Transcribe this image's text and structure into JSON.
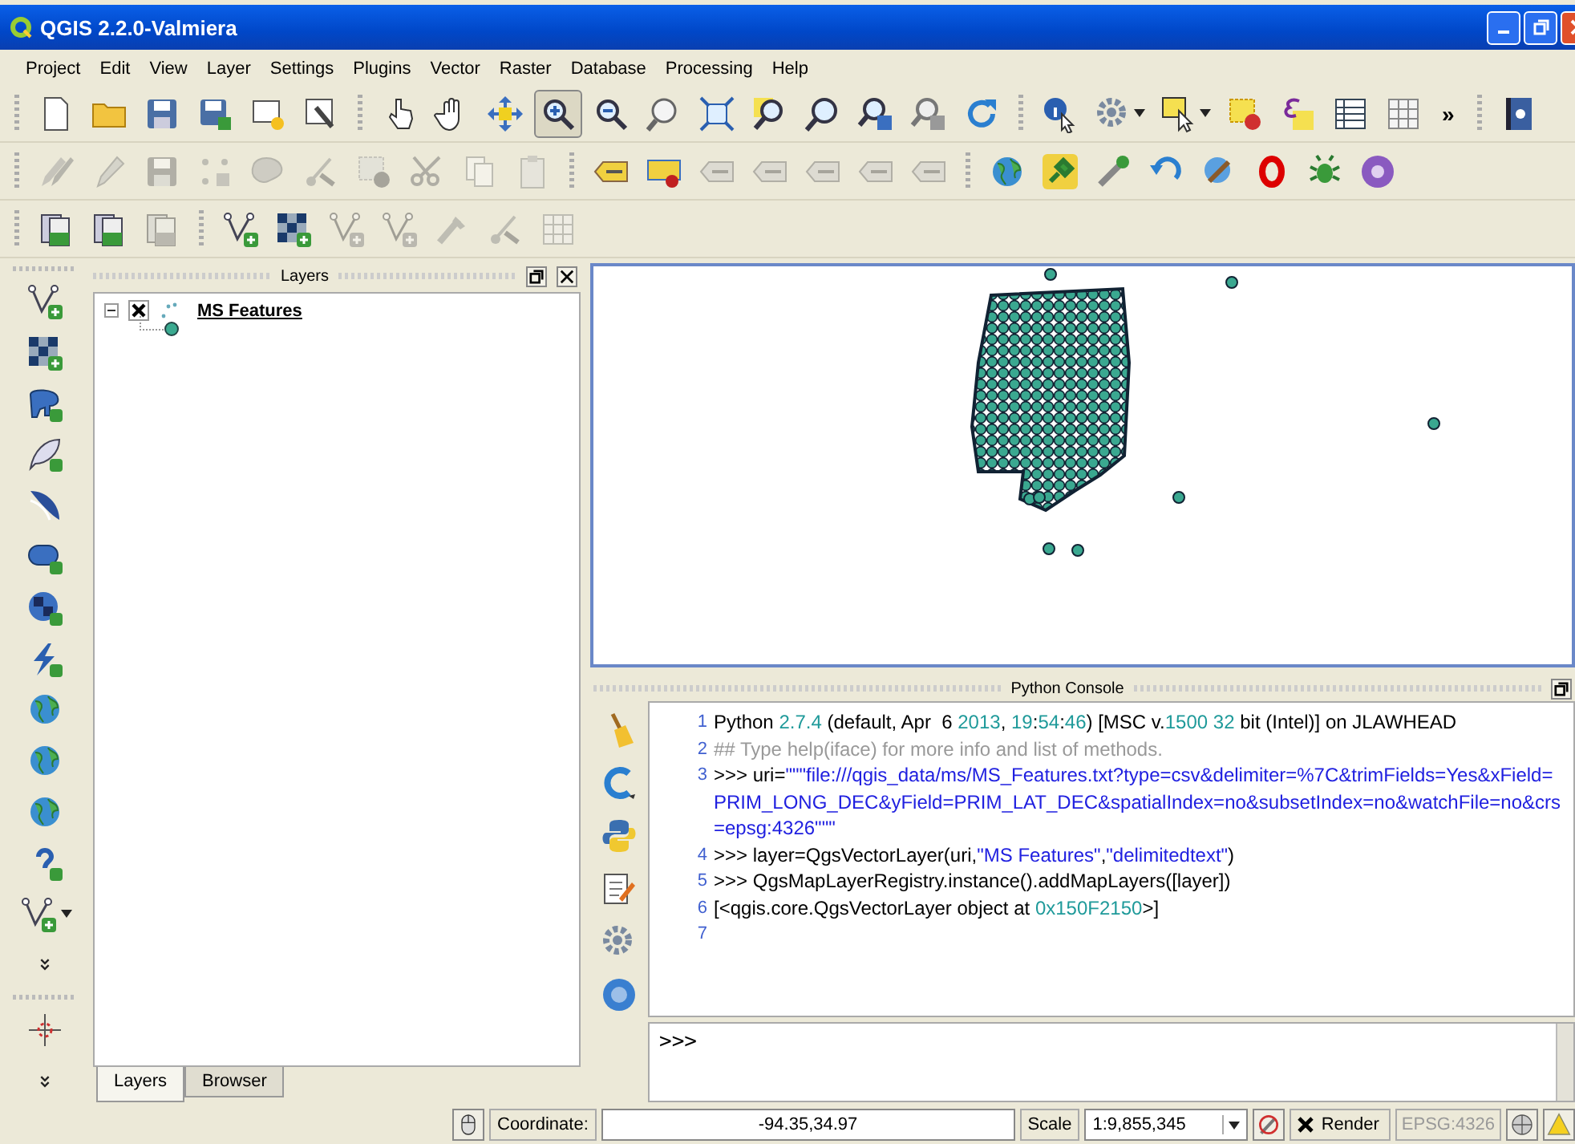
{
  "window": {
    "title": "QGIS 2.2.0-Valmiera"
  },
  "menu": [
    {
      "label": "Project"
    },
    {
      "label": "Edit"
    },
    {
      "label": "View"
    },
    {
      "label": "Layer"
    },
    {
      "label": "Settings"
    },
    {
      "label": "Plugins"
    },
    {
      "label": "Vector"
    },
    {
      "label": "Raster"
    },
    {
      "label": "Database"
    },
    {
      "label": "Processing"
    },
    {
      "label": "Help"
    }
  ],
  "toolbars": [
    {
      "groups": [
        {
          "buttons": [
            {
              "kind": "page",
              "disabled": false,
              "selected": false
            },
            {
              "kind": "folder",
              "disabled": false,
              "selected": false
            },
            {
              "kind": "disk",
              "disabled": false,
              "selected": false
            },
            {
              "kind": "diskpen",
              "disabled": false,
              "selected": false
            },
            {
              "kind": "pagestar",
              "disabled": false,
              "selected": false
            },
            {
              "kind": "pagetool",
              "disabled": false,
              "selected": false
            }
          ]
        },
        {
          "buttons": [
            {
              "kind": "pointer",
              "disabled": false,
              "selected": false
            },
            {
              "kind": "hand",
              "disabled": false,
              "selected": false
            },
            {
              "kind": "move",
              "disabled": false,
              "selected": false
            },
            {
              "kind": "magplus",
              "disabled": false,
              "selected": true
            },
            {
              "kind": "magminus",
              "disabled": false,
              "selected": false
            },
            {
              "kind": "magone",
              "disabled": false,
              "selected": false
            },
            {
              "kind": "extent",
              "disabled": false,
              "selected": false
            },
            {
              "kind": "magbox",
              "disabled": false,
              "selected": false
            },
            {
              "kind": "magnifier",
              "disabled": false,
              "selected": false
            },
            {
              "kind": "magback",
              "disabled": false,
              "selected": false
            },
            {
              "kind": "magnext",
              "disabled": false,
              "selected": false
            },
            {
              "kind": "refresh",
              "disabled": false,
              "selected": false
            }
          ]
        },
        {
          "buttons": [
            {
              "kind": "info",
              "disabled": false,
              "selected": false
            },
            {
              "kind": "gear",
              "disabled": false,
              "selected": false,
              "dropdown": true
            },
            {
              "kind": "select",
              "disabled": false,
              "selected": false,
              "dropdown": true
            },
            {
              "kind": "deselect",
              "disabled": false,
              "selected": false
            },
            {
              "kind": "formula",
              "disabled": false,
              "selected": false
            },
            {
              "kind": "table",
              "disabled": false,
              "selected": false
            },
            {
              "kind": "grid",
              "disabled": false,
              "selected": false
            }
          ],
          "more": "»"
        },
        {
          "buttons": [
            {
              "kind": "book",
              "disabled": false,
              "selected": false
            }
          ]
        }
      ]
    },
    {
      "groups": [
        {
          "buttons": [
            {
              "kind": "pencils",
              "disabled": true
            },
            {
              "kind": "pencil",
              "disabled": true
            },
            {
              "kind": "disk",
              "disabled": true
            },
            {
              "kind": "points",
              "disabled": true
            },
            {
              "kind": "shape",
              "disabled": true
            },
            {
              "kind": "node",
              "disabled": true
            },
            {
              "kind": "deselect",
              "disabled": true
            },
            {
              "kind": "scissors",
              "disabled": true
            },
            {
              "kind": "copy",
              "disabled": true
            },
            {
              "kind": "paste",
              "disabled": true
            }
          ]
        },
        {
          "buttons": [
            {
              "kind": "label",
              "disabled": false
            },
            {
              "kind": "labelpin",
              "disabled": false
            },
            {
              "kind": "label",
              "disabled": true
            },
            {
              "kind": "label",
              "disabled": true
            },
            {
              "kind": "label",
              "disabled": true
            },
            {
              "kind": "label",
              "disabled": true
            },
            {
              "kind": "label",
              "disabled": true
            }
          ]
        },
        {
          "buttons": [
            {
              "kind": "globe",
              "disabled": false
            },
            {
              "kind": "plug",
              "disabled": false
            },
            {
              "kind": "wrench",
              "disabled": false
            },
            {
              "kind": "undo",
              "disabled": false
            },
            {
              "kind": "magtool",
              "disabled": false
            },
            {
              "kind": "ring",
              "disabled": false
            },
            {
              "kind": "bug",
              "disabled": false
            },
            {
              "kind": "disc",
              "disabled": false
            }
          ]
        }
      ]
    },
    {
      "groups": [
        {
          "buttons": [
            {
              "kind": "layers",
              "disabled": false
            },
            {
              "kind": "layers",
              "disabled": false
            },
            {
              "kind": "layers",
              "disabled": true
            }
          ]
        },
        {
          "buttons": [
            {
              "kind": "vectoradd",
              "disabled": false
            },
            {
              "kind": "rasteradd",
              "disabled": false
            },
            {
              "kind": "vectoradd",
              "disabled": true
            },
            {
              "kind": "vectoradd",
              "disabled": true
            },
            {
              "kind": "tool",
              "disabled": true
            },
            {
              "kind": "node",
              "disabled": true
            },
            {
              "kind": "grid",
              "disabled": true
            }
          ]
        }
      ]
    }
  ],
  "left_toolbar": [
    {
      "kind": "vectoradd"
    },
    {
      "kind": "rasteradd"
    },
    {
      "kind": "elephant"
    },
    {
      "kind": "feather"
    },
    {
      "kind": "wave"
    },
    {
      "kind": "oval"
    },
    {
      "kind": "checkglobe"
    },
    {
      "kind": "bolt"
    },
    {
      "kind": "globe"
    },
    {
      "kind": "globe"
    },
    {
      "kind": "globe"
    },
    {
      "kind": "hook"
    },
    {
      "kind": "vectoradd",
      "dropdown": true
    },
    {
      "kind": "chevron"
    },
    {
      "kind": "crosshair"
    },
    {
      "kind": "chevron"
    }
  ],
  "layers_panel": {
    "title": "Layers",
    "layers": [
      {
        "name": "MS Features",
        "expanded": true,
        "checked": true
      }
    ]
  },
  "panel_tabs": [
    {
      "label": "Layers",
      "selected": true
    },
    {
      "label": "Browser",
      "selected": false
    }
  ],
  "console": {
    "title": "Python Console",
    "tools": [
      {
        "kind": "broom"
      },
      {
        "kind": "clear"
      },
      {
        "kind": "python"
      },
      {
        "kind": "editor"
      },
      {
        "kind": "gear"
      },
      {
        "kind": "help"
      }
    ],
    "lines": [
      {
        "number": "1",
        "parts": [
          {
            "kind": "plain",
            "text": "Python "
          },
          {
            "kind": "number",
            "text": "2.7.4"
          },
          {
            "kind": "plain",
            "text": " (default, Apr  6 "
          },
          {
            "kind": "number",
            "text": "2013"
          },
          {
            "kind": "plain",
            "text": ", "
          },
          {
            "kind": "number",
            "text": "19"
          },
          {
            "kind": "plain",
            "text": ":"
          },
          {
            "kind": "number",
            "text": "54"
          },
          {
            "kind": "plain",
            "text": ":"
          },
          {
            "kind": "number",
            "text": "46"
          },
          {
            "kind": "plain",
            "text": ") [MSC v."
          },
          {
            "kind": "number",
            "text": "1500 32"
          },
          {
            "kind": "plain",
            "text": " bit (Intel)] on JLAWHEAD"
          }
        ]
      },
      {
        "number": "2",
        "parts": [
          {
            "kind": "comment",
            "text": "## Type help(iface) for more info and list of methods."
          }
        ]
      },
      {
        "number": "3",
        "parts": [
          {
            "kind": "plain",
            "text": ">>> uri="
          },
          {
            "kind": "string",
            "text": "\"\"\"file:///qgis_data/ms/MS_Features.txt?type=csv&delimiter=%7C&trimFields=Yes&xField=PRIM_LONG_DEC&yField=PRIM_LAT_DEC&spatialIndex=no&subsetIndex=no&watchFile=no&crs=epsg:4326\"\"\""
          }
        ]
      },
      {
        "number": "4",
        "parts": [
          {
            "kind": "plain",
            "text": ">>> layer=QgsVectorLayer(uri,"
          },
          {
            "kind": "string",
            "text": "\"MS Features\""
          },
          {
            "kind": "plain",
            "text": ","
          },
          {
            "kind": "string",
            "text": "\"delimitedtext\""
          },
          {
            "kind": "plain",
            "text": ")"
          }
        ]
      },
      {
        "number": "5",
        "parts": [
          {
            "kind": "plain",
            "text": ">>> QgsMapLayerRegistry.instance().addMapLayers([layer])"
          }
        ]
      },
      {
        "number": "6",
        "parts": [
          {
            "kind": "plain",
            "text": "[<qgis.core.QgsVectorLayer object at "
          },
          {
            "kind": "number",
            "text": "0x150F2150"
          },
          {
            "kind": "plain",
            "text": ">]"
          }
        ]
      },
      {
        "number": "7"
      }
    ],
    "prompt": ">>>"
  },
  "status_bar": {
    "coordinate_label": "Coordinate:",
    "coordinate": "-94.35,34.97",
    "scale_label": "Scale",
    "scale": "1:9,855,345",
    "render": {
      "label": "Render",
      "checked": true
    },
    "crs": "EPSG:4326"
  }
}
